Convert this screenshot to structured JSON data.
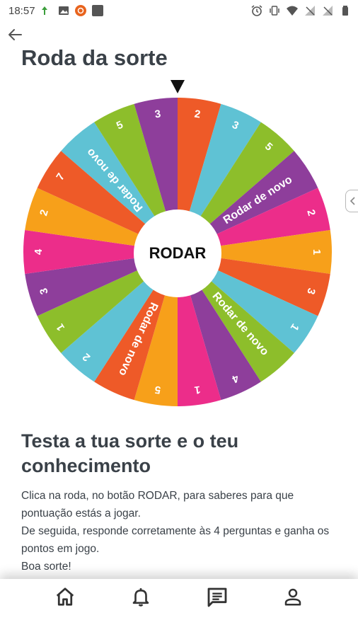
{
  "status_bar": {
    "time": "18:57",
    "left_icons": [
      "data-arrow-icon",
      "image-icon",
      "notification-badge-icon",
      "app-square-icon"
    ],
    "right_icons": [
      "alarm-icon",
      "vibrate-icon",
      "wifi-icon",
      "no-signal-icon",
      "no-signal-icon",
      "battery-icon"
    ]
  },
  "header": {
    "back_icon": "arrow-left-icon",
    "title": "Roda da sorte"
  },
  "wheel": {
    "center_label": "RODAR",
    "pointer_icon": "triangle-down-icon",
    "segments": [
      {
        "label": "2",
        "color": "#EE5A28"
      },
      {
        "label": "3",
        "color": "#5FC2D4"
      },
      {
        "label": "5",
        "color": "#8DBE2B"
      },
      {
        "label": "Rodar de novo",
        "color": "#8E3E9B"
      },
      {
        "label": "2",
        "color": "#EC2D8A"
      },
      {
        "label": "1",
        "color": "#F7A01A"
      },
      {
        "label": "3",
        "color": "#EE5A28"
      },
      {
        "label": "1",
        "color": "#5FC2D4"
      },
      {
        "label": "Rodar de novo",
        "color": "#8DBE2B"
      },
      {
        "label": "4",
        "color": "#8E3E9B"
      },
      {
        "label": "1",
        "color": "#EC2D8A"
      },
      {
        "label": "5",
        "color": "#F7A01A"
      },
      {
        "label": "Rodar de novo",
        "color": "#EE5A28"
      },
      {
        "label": "2",
        "color": "#5FC2D4"
      },
      {
        "label": "1",
        "color": "#8DBE2B"
      },
      {
        "label": "3",
        "color": "#8E3E9B"
      },
      {
        "label": "4",
        "color": "#EC2D8A"
      },
      {
        "label": "2",
        "color": "#F7A01A"
      },
      {
        "label": "7",
        "color": "#EE5A28"
      },
      {
        "label": "Rodar de novo",
        "color": "#5FC2D4"
      },
      {
        "label": "5",
        "color": "#8DBE2B"
      },
      {
        "label": "3",
        "color": "#8E3E9B"
      }
    ]
  },
  "side_tab_icon": "chevron-left-icon",
  "content": {
    "title": "Testa a tua sorte e o teu conhecimento",
    "lines": [
      "Clica na roda, no botão RODAR, para saberes para que pontuação estás a jogar.",
      "De seguida, responde corretamente às 4 perguntas e ganha os pontos em jogo.",
      "Boa sorte!"
    ]
  },
  "bottom_nav": [
    {
      "icon": "home-icon",
      "name": "home"
    },
    {
      "icon": "bell-icon",
      "name": "notifications"
    },
    {
      "icon": "message-icon",
      "name": "messages"
    },
    {
      "icon": "person-icon",
      "name": "profile"
    }
  ]
}
